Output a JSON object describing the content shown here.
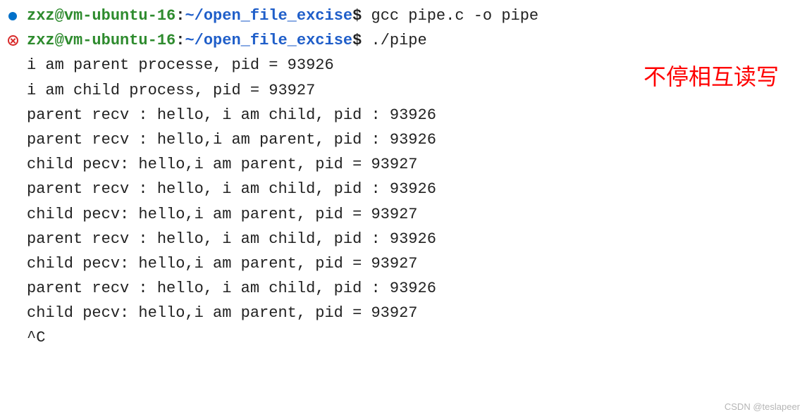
{
  "prompt": {
    "user": "zxz",
    "at": "@",
    "host": "vm-ubuntu-16",
    "colon": ":",
    "path": "~/open_file_excise",
    "dollar": "$"
  },
  "cmd1": " gcc pipe.c -o pipe",
  "cmd2": " ./pipe",
  "output": [
    "i am parent processe, pid = 93926",
    "i am child process, pid = 93927",
    "parent recv : hello, i am child, pid : 93926",
    "parent recv : hello,i am parent, pid : 93926",
    "child pecv: hello,i am parent, pid = 93927",
    "parent recv : hello, i am child, pid : 93926",
    "child pecv: hello,i am parent, pid = 93927",
    "parent recv : hello, i am child, pid : 93926",
    "child pecv: hello,i am parent, pid = 93927",
    "parent recv : hello, i am child, pid : 93926",
    "child pecv: hello,i am parent, pid = 93927",
    "^C"
  ],
  "annotation": "不停相互读写",
  "watermark": "CSDN @teslapeer"
}
